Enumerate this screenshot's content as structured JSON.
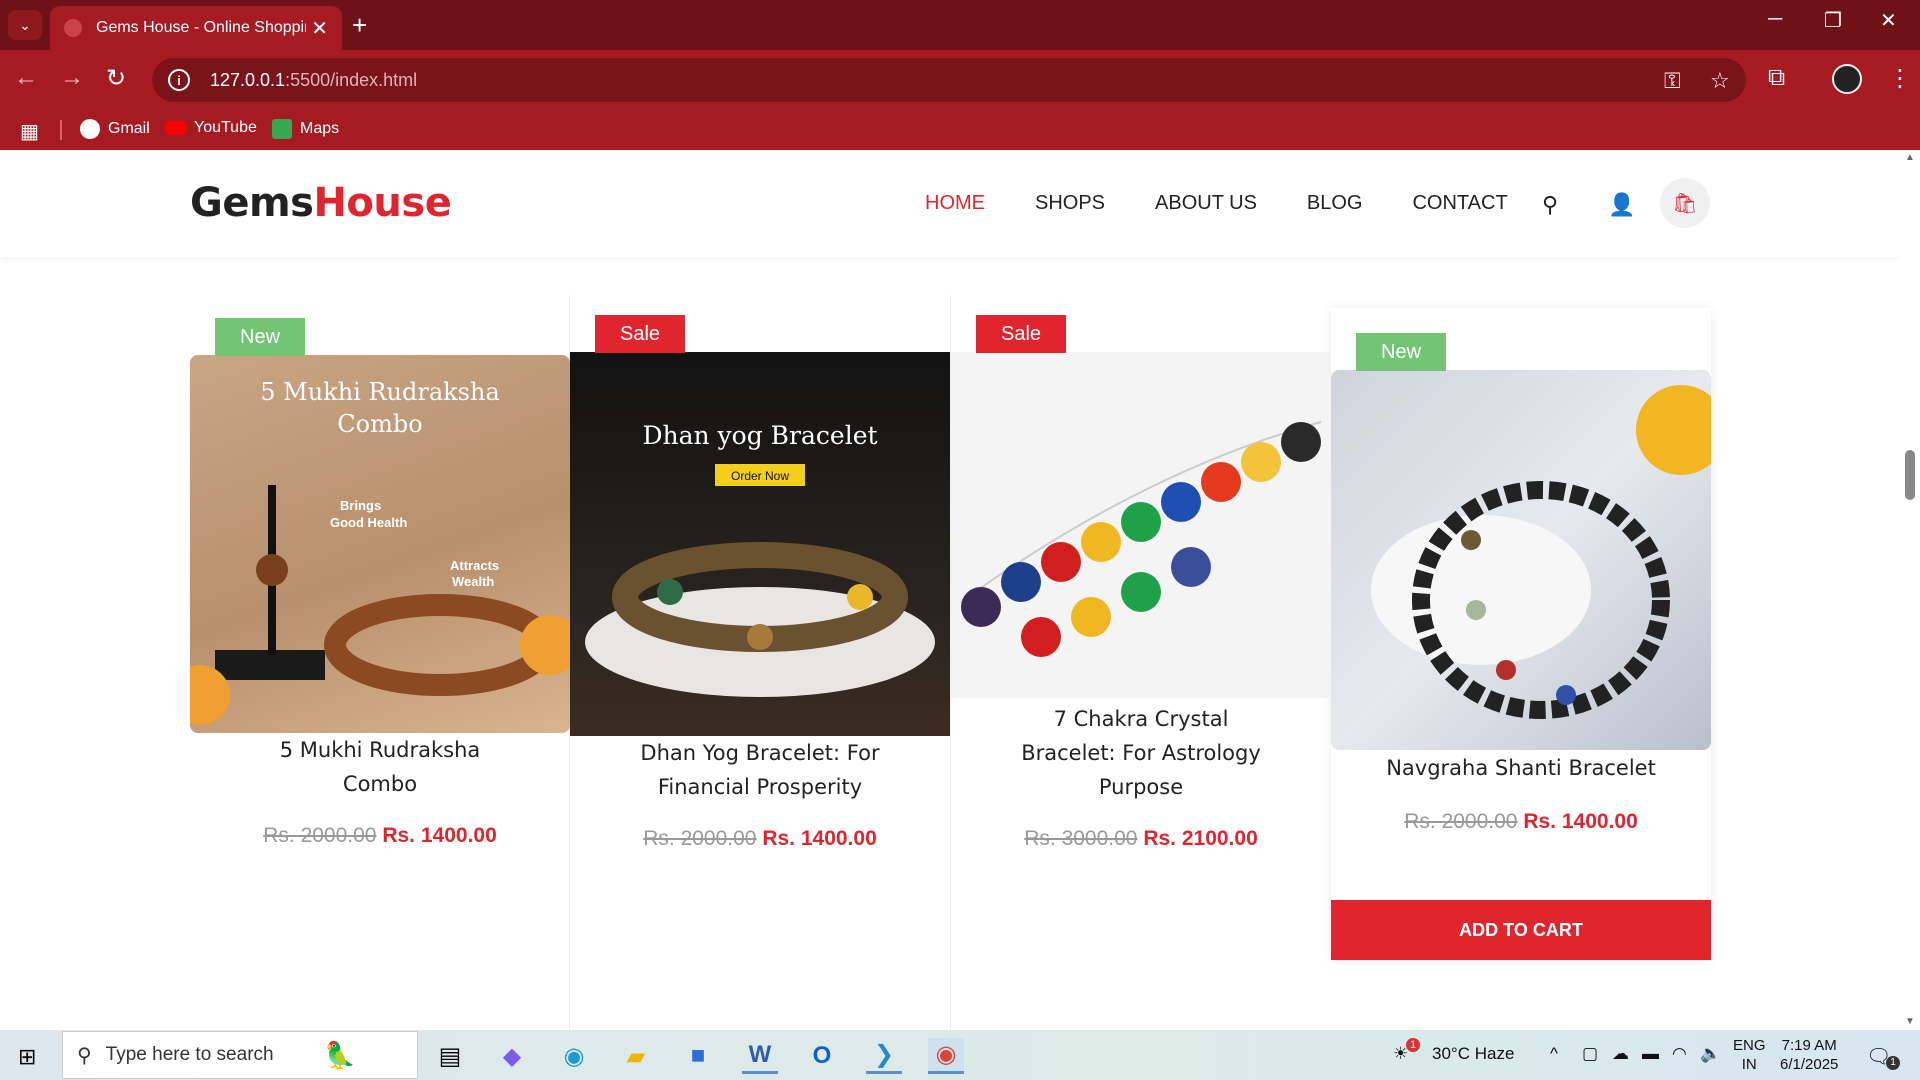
{
  "browser": {
    "tab_title": "Gems House - Online Shopping",
    "url_host": "127.0.0.1",
    "url_rest": ":5500/index.html",
    "bookmarks": [
      "Gmail",
      "YouTube",
      "Maps"
    ]
  },
  "site": {
    "logo_a": "Gems",
    "logo_b": "House",
    "nav": [
      "HOME",
      "SHOPS",
      "ABOUT US",
      "BLOG",
      "CONTACT"
    ]
  },
  "products": [
    {
      "badge": "New",
      "name_line1": "5 Mukhi Rudraksha",
      "name_line2": "Combo",
      "name_line3": "",
      "old_price": "Rs. 2000.00",
      "price": "Rs. 1400.00",
      "img_title1": "5 Mukhi Rudraksha",
      "img_title2": "Combo",
      "img_note1": "Brings",
      "img_note2": "Good Health",
      "img_note3": "Attracts",
      "img_note4": "Wealth"
    },
    {
      "badge": "Sale",
      "name_line1": "Dhan Yog Bracelet: For",
      "name_line2": "Financial Prosperity",
      "name_line3": "",
      "old_price": "Rs. 2000.00",
      "price": "Rs. 1400.00",
      "img_title1": "Dhan yog Bracelet",
      "img_button": "Order Now"
    },
    {
      "badge": "Sale",
      "name_line1": "7 Chakra Crystal",
      "name_line2": "Bracelet: For Astrology",
      "name_line3": "Purpose",
      "old_price": "Rs. 3000.00",
      "price": "Rs. 2100.00"
    },
    {
      "badge": "New",
      "name_line1": "Navgraha Shanti Bracelet",
      "name_line2": "",
      "name_line3": "",
      "old_price": "Rs. 2000.00",
      "price": "Rs. 1400.00"
    }
  ],
  "add_to_cart": "ADD TO CART",
  "taskbar": {
    "search_placeholder": "Type here to search",
    "weather": "30°C  Haze",
    "lang1": "ENG",
    "lang2": "IN",
    "time": "7:19 AM",
    "date": "6/1/2025",
    "weather_badge": "1",
    "notif_count": "1"
  }
}
